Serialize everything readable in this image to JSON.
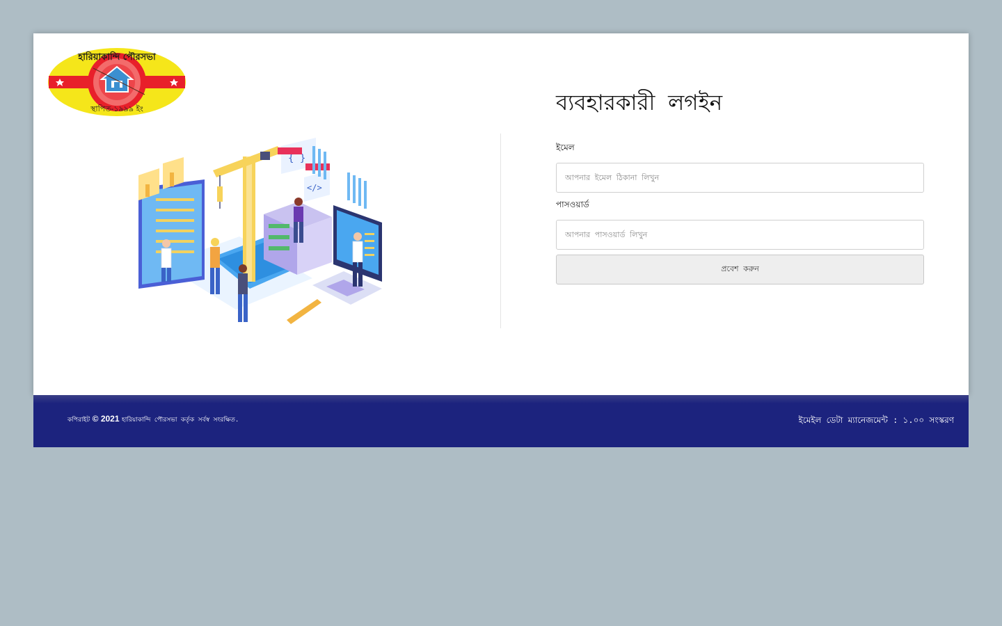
{
  "logo": {
    "name": "municipality-logo",
    "text_top": "হারিয়াকান্দি পৌরসভা",
    "text_bottom": "স্থাপিত-১৯৯৯ ইং",
    "colors": {
      "outer": "#f5e61a",
      "ring": "#e8202a",
      "inner": "#f36b6b",
      "house": "#3b8fd0"
    }
  },
  "login": {
    "title": "ব্যবহারকারী লগইন",
    "email_label": "ইমেল",
    "email_placeholder": "আপনার ইমেল ঠিকানা লিখুন",
    "password_label": "পাসওয়ার্ড",
    "password_placeholder": "আপনার পাসওয়ার্ড লিখুন",
    "submit_label": "প্রবেশ করুন"
  },
  "footer": {
    "copyright_prefix": "কপিরাইট",
    "copyright_year": "© 2021",
    "copyright_rest": "হারিয়াকান্দি পৌরসভা কর্তৃক সর্বস্ব সংরক্ষিত.",
    "version_label": "ইমেইল ডেটা ম্যানেজমেন্ট : ১.০০ সংস্করণ"
  },
  "colors": {
    "page_background": "#aebdc5",
    "card_background": "#ffffff",
    "footer_background": "#1c237e"
  }
}
